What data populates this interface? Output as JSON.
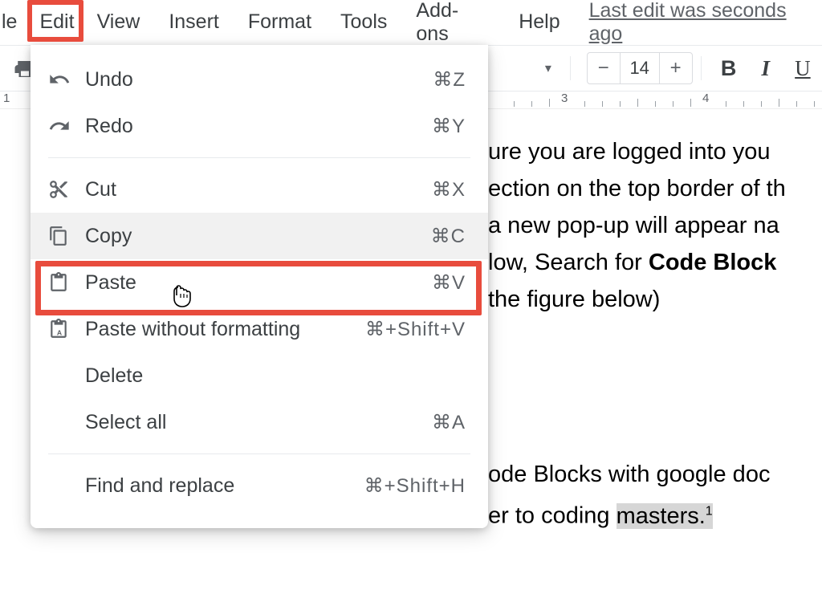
{
  "menubar": {
    "items": [
      "le",
      "Edit",
      "View",
      "Insert",
      "Format",
      "Tools",
      "Add-ons",
      "Help"
    ],
    "last_edit": "Last edit was seconds ago"
  },
  "toolbar": {
    "font_dropdown_symbol": "▾",
    "font_minus": "−",
    "font_size": "14",
    "font_plus": "+",
    "bold": "B",
    "italic": "I",
    "underline": "U"
  },
  "ruler": {
    "start": "1",
    "n3": "3",
    "n4": "4"
  },
  "dropdown": {
    "undo": {
      "label": "Undo",
      "shortcut": "⌘Z"
    },
    "redo": {
      "label": "Redo",
      "shortcut": "⌘Y"
    },
    "cut": {
      "label": "Cut",
      "shortcut": "⌘X"
    },
    "copy": {
      "label": "Copy",
      "shortcut": "⌘C"
    },
    "paste": {
      "label": "Paste",
      "shortcut": "⌘V"
    },
    "paste_nofmt": {
      "label": "Paste without formatting",
      "shortcut": "⌘+Shift+V"
    },
    "delete": {
      "label": "Delete",
      "shortcut": ""
    },
    "select_all": {
      "label": "Select all",
      "shortcut": "⌘A"
    },
    "find_replace": {
      "label": "Find and replace",
      "shortcut": "⌘+Shift+H"
    }
  },
  "document": {
    "p1_l1": "ure you are logged into you",
    "p1_l2": "ection on the top border of th",
    "p1_l3": "a new pop-up will appear na",
    "p1_l4a": "low, Search for ",
    "p1_l4b": "Code Block",
    "p1_l5": "the figure below)",
    "p2_l1": "ode Blocks with google doc",
    "p2_l2a": "er to coding ",
    "p2_l2b": "masters.",
    "p2_sup": "1"
  }
}
